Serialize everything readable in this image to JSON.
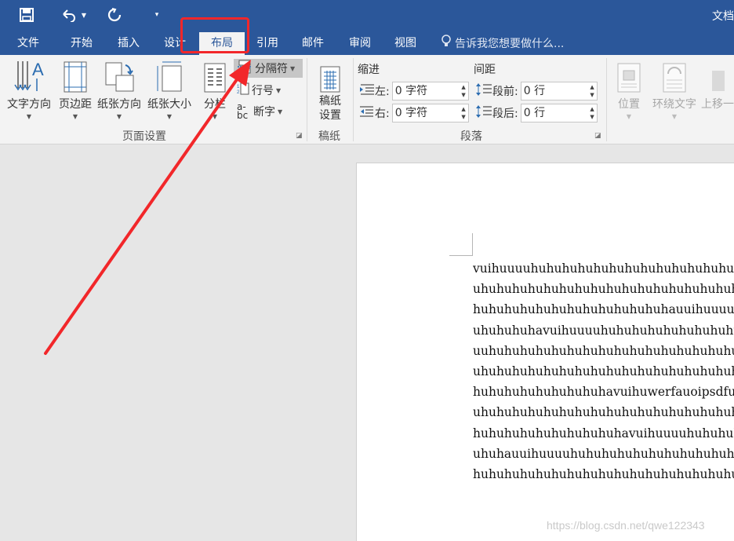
{
  "window": {
    "title": "文档"
  },
  "quick_access": [
    {
      "name": "save-icon"
    },
    {
      "name": "undo-icon"
    },
    {
      "name": "redo-icon"
    },
    {
      "name": "customize-icon"
    }
  ],
  "tabs": [
    {
      "label": "文件"
    },
    {
      "label": "开始"
    },
    {
      "label": "插入"
    },
    {
      "label": "设计"
    },
    {
      "label": "布局",
      "active": true
    },
    {
      "label": "引用"
    },
    {
      "label": "邮件"
    },
    {
      "label": "审阅"
    },
    {
      "label": "视图"
    }
  ],
  "tell_me": {
    "text": "告诉我您想要做什么..."
  },
  "ribbon": {
    "page_setup": {
      "group_label": "页面设置",
      "text_direction": "文字方向",
      "margins": "页边距",
      "orientation": "纸张方向",
      "size": "纸张大小",
      "columns": "分栏",
      "breaks": "分隔符",
      "line_numbers": "行号",
      "hyphenation": "断字"
    },
    "manuscript": {
      "group_label": "稿纸",
      "settings_line1": "稿纸",
      "settings_line2": "设置"
    },
    "paragraph": {
      "group_label": "段落",
      "indent_header": "缩进",
      "spacing_header": "间距",
      "left_label": "左:",
      "left_value": "0 字符",
      "right_label": "右:",
      "right_value": "0 字符",
      "before_label": "段前:",
      "before_value": "0 行",
      "after_label": "段后:",
      "after_value": "0 行"
    },
    "arrange": {
      "position": "位置",
      "wrap_text": "环绕文字",
      "bring_forward": "上移一"
    }
  },
  "document": {
    "lines": [
      "vuihuuuuhuhuhuhuhuhuhuhuhuhuhuhuhuhuhu",
      "uhuhuhuhuhuhuhuhuhuhuhuhuhuhuhuhuhuhuhuhu",
      "huhuhuhuhuhuhuhuhuhuhuhuhauuihuuuuhuhu",
      "uhuhuhuhavuihuuuuhuhuhuhuhuhuhuhuhuhuhu",
      "uuhuhuhuhuhuhuhuhuhuhuhuhuhuhuhuhuhuhuhu",
      "uhuhuhuhuhuhuhuhuhuhuhuhuhuhuhuhuhauuihu",
      "huhuhuhuhuhuhuhuhavuihuwerfauoipsdfuio",
      "uhuhuhuhuhuhuhuhuhuhuhuhuhuhuhuhuhuhuhuhu",
      "huhuhuhuhuhuhuhuhuhavuihuuuuhuhuhuhuhu",
      "uhuhauuihuuuuhuhuhuhuhuhuhuhuhuhuhuhuhu",
      "huhuhuhuhuhuhuhuhuhuhuhuhuhuhuhuhu"
    ],
    "paragraph_mark": "↵"
  },
  "watermark": "https://blog.csdn.net/qwe122343",
  "colors": {
    "accent": "#2b579a",
    "annotation": "#f2272a"
  }
}
